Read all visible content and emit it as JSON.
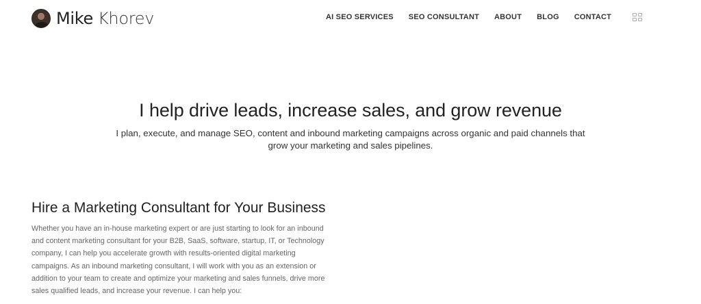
{
  "header": {
    "brand": {
      "first": "Mike",
      "last": "Khorev"
    },
    "nav": [
      {
        "label": "AI SEO SERVICES"
      },
      {
        "label": "SEO CONSULTANT"
      },
      {
        "label": "ABOUT"
      },
      {
        "label": "BLOG"
      },
      {
        "label": "CONTACT"
      }
    ],
    "language_icon": "language-flag-icon"
  },
  "hero": {
    "title": "I help drive leads, increase sales, and grow revenue",
    "subtitle": "I plan, execute, and manage SEO, content and inbound marketing campaigns across organic and paid channels that grow your marketing and sales pipelines."
  },
  "section": {
    "heading": "Hire a Marketing Consultant for Your Business",
    "body": "Whether you have an in-house marketing expert or are just starting to look for an inbound and content marketing consultant for your B2B, SaaS, software, startup, IT, or Technology company, I can help you accelerate growth with results-oriented digital marketing campaigns. As an inbound marketing consultant, I will work with you as an extension or addition to your team to create and optimize your marketing and sales funnels, drive more sales qualified leads, and increase your revenue. I can help you:"
  }
}
